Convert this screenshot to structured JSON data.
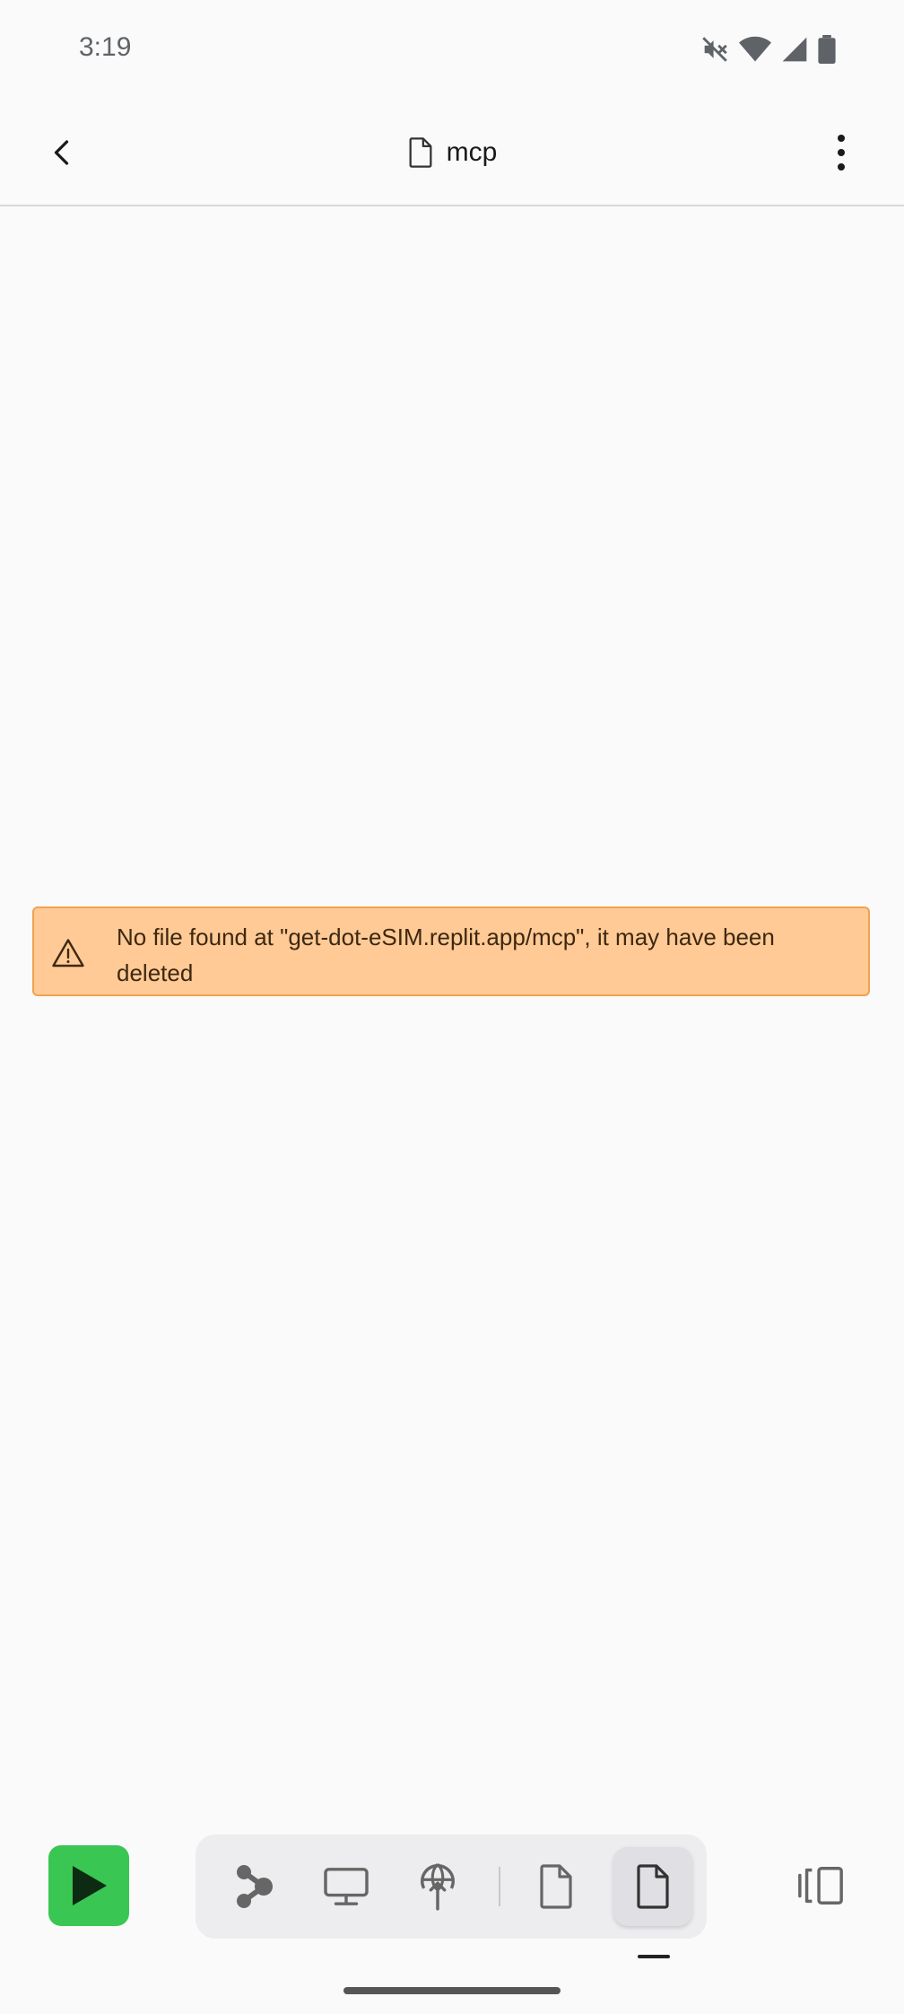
{
  "status": {
    "time": "3:19",
    "icons": [
      "mute-icon",
      "wifi-icon",
      "signal-icon",
      "battery-icon"
    ]
  },
  "header": {
    "title": "mcp",
    "title_icon": "file-icon",
    "back_icon": "chevron-left-icon",
    "menu_icon": "more-vertical-icon"
  },
  "warning": {
    "icon": "warning-triangle-icon",
    "message": "No file found at \"get-dot-eSIM.replit.app/mcp\", it may have been deleted",
    "background": "#ffca96",
    "border": "#f2a24f"
  },
  "toolbar": {
    "run_icon": "play-icon",
    "run_color": "#3ac653",
    "tools": [
      {
        "icon": "agent-nodes-icon"
      },
      {
        "icon": "monitor-icon"
      },
      {
        "icon": "deploy-globe-icon"
      },
      {
        "icon": "file-icon"
      },
      {
        "icon": "file-icon",
        "active": true
      }
    ],
    "split_icon": "split-pane-icon"
  }
}
